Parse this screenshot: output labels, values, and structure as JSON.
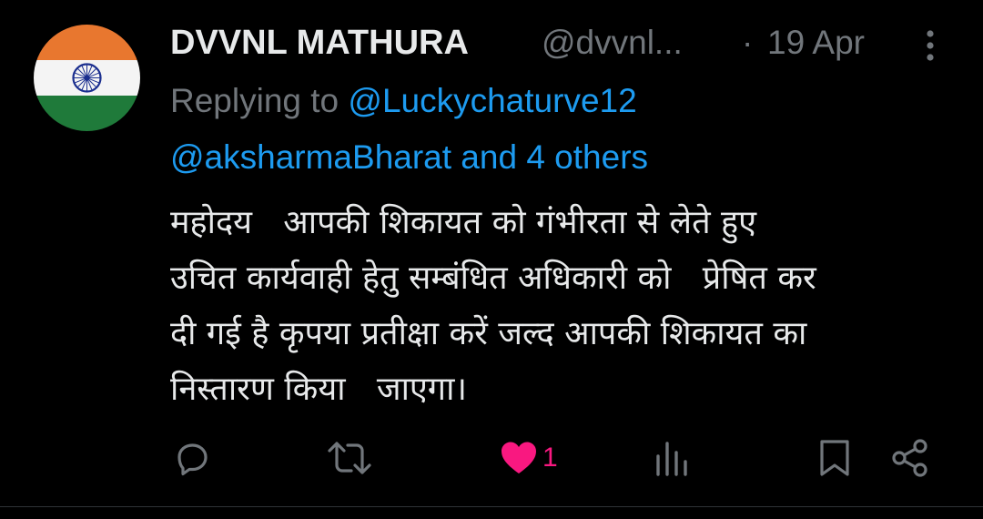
{
  "tweet": {
    "display_name": "DVVNL MATHURA",
    "handle": "@dvvnl...",
    "separator": "·",
    "timestamp": "19 Apr",
    "replying_prefix": "Replying to",
    "replying_first": "@Luckychaturve12",
    "replying_second": "@aksharmaBharat and 4 others",
    "body_lines": [
      "महोदय   आपकी शिकायत को गंभीरता से लेते हुए",
      "उचित कार्यवाही हेतु सम्बंधित अधिकारी को   प्रेषित कर",
      "दी गई है कृपया प्रतीक्षा करें जल्द आपकी शिकायत का",
      "निस्तारण किया   जाएगा।"
    ],
    "like_count": "1",
    "liked": true
  },
  "icons": {
    "avatar": "india-flag",
    "more": "more-vertical-icon",
    "reply": "reply-icon",
    "retweet": "retweet-icon",
    "like": "heart-icon",
    "views": "views-icon",
    "bookmark": "bookmark-icon",
    "share": "share-icon"
  },
  "colors": {
    "background": "#000000",
    "primary_text": "#e7e9ea",
    "secondary_text": "#71767b",
    "link": "#1d9bf0",
    "like": "#f91880"
  }
}
